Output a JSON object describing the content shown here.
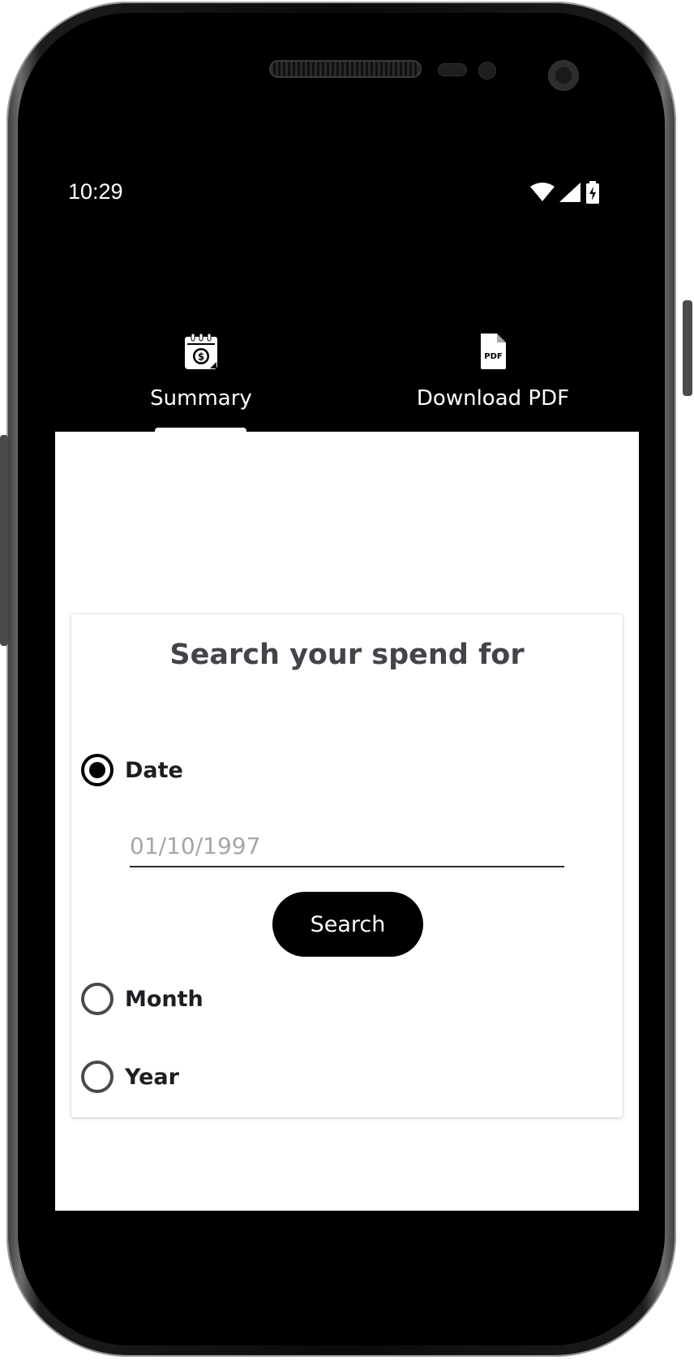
{
  "status_bar": {
    "time": "10:29",
    "icons": [
      "wifi-icon",
      "signal-icon",
      "battery-charging-icon"
    ]
  },
  "tabs": [
    {
      "label": "Summary",
      "icon": "calendar-dollar-icon",
      "selected": true
    },
    {
      "label": "Download PDF",
      "icon": "pdf-file-icon",
      "selected": false
    }
  ],
  "card": {
    "title": "Search your spend for",
    "options": [
      {
        "label": "Date",
        "selected": true
      },
      {
        "label": "Month",
        "selected": false
      },
      {
        "label": "Year",
        "selected": false
      }
    ],
    "date_input": {
      "placeholder": "01/10/1997",
      "value": ""
    },
    "search_label": "Search"
  },
  "colors": {
    "header_bg": "#000000",
    "card_title": "#44434a",
    "button_bg": "#000000",
    "placeholder": "#a6a6a6"
  }
}
